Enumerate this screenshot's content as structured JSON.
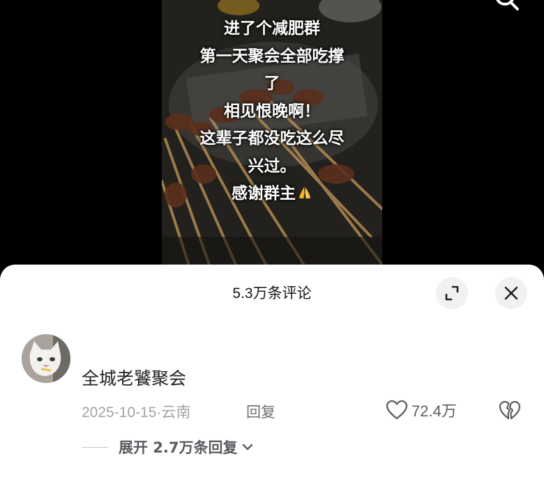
{
  "video": {
    "overlay_lines": [
      "进了个减肥群",
      "第一天聚会全部吃撑",
      "了",
      "相见恨晚啊！",
      "这辈子都没吃这么尽",
      "兴过。",
      "感谢群主"
    ],
    "overlay_emoji": "pray-icon"
  },
  "comment_sheet": {
    "title": "5.3万条评论",
    "comment": {
      "username": "全城老饕聚会",
      "date_location": "2025-10-15·云南",
      "reply_label": "回复",
      "like_count": "72.4万",
      "expand_replies_label": "展开 2.7万条回复"
    }
  },
  "icons": [
    "search-icon",
    "expand-icon",
    "close-icon",
    "heart-icon",
    "broken-heart-icon",
    "chevron-down-icon"
  ],
  "colors": {
    "sheet_bg": "#ffffff",
    "text_primary": "#161616",
    "text_muted": "#a3a3a6",
    "button_bg": "#f1f1f2"
  }
}
